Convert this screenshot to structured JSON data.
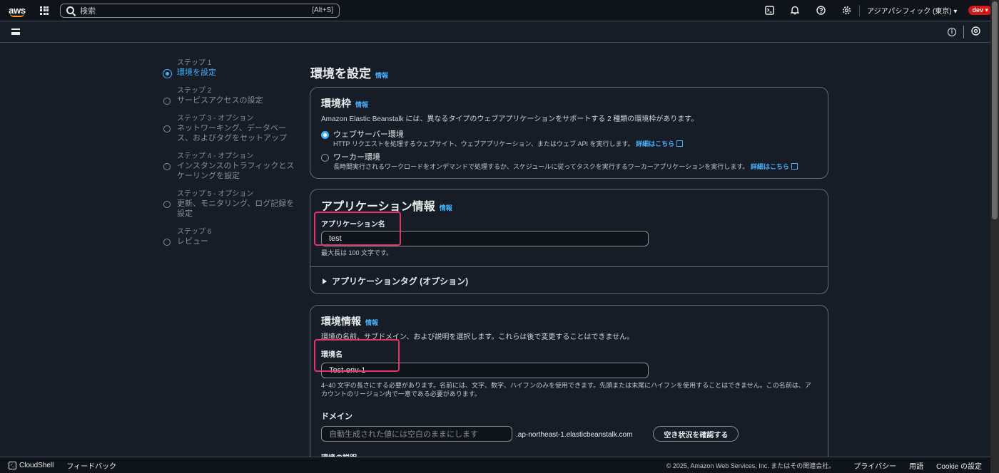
{
  "topnav": {
    "logo": "aws",
    "search_placeholder": "検索",
    "search_shortcut": "[Alt+S]",
    "icons": [
      "cloudshell-icon",
      "bell-icon",
      "help-icon",
      "gear-icon"
    ],
    "region": "アジアパシフィック (東京)",
    "account": "dev"
  },
  "steps": [
    {
      "num": "ステップ 1",
      "title": "環境を設定",
      "active": true
    },
    {
      "num": "ステップ 2",
      "title": "サービスアクセスの設定",
      "active": false
    },
    {
      "num": "ステップ 3 - オプション",
      "title": "ネットワーキング、データベース、およびタグをセットアップ",
      "active": false
    },
    {
      "num": "ステップ 4 - オプション",
      "title": "インスタンスのトラフィックとスケーリングを設定",
      "active": false
    },
    {
      "num": "ステップ 5 - オプション",
      "title": "更新、モニタリング、ログ記録を設定",
      "active": false
    },
    {
      "num": "ステップ 6",
      "title": "レビュー",
      "active": false
    }
  ],
  "page": {
    "title": "環境を設定",
    "info": "情報"
  },
  "env_tier": {
    "title": "環境枠",
    "info": "情報",
    "desc": "Amazon Elastic Beanstalk には、異なるタイプのウェブアプリケーションをサポートする 2 種類の環境枠があります。",
    "options": [
      {
        "label": "ウェブサーバー環境",
        "desc": "HTTP リクエストを処理するウェブサイト、ウェブアプリケーション、またはウェブ API を実行します。",
        "link": "詳細はこちら",
        "selected": true
      },
      {
        "label": "ワーカー環境",
        "desc": "長時間実行されるワークロードをオンデマンドで処理するか、スケジュールに従ってタスクを実行するワーカーアプリケーションを実行します。",
        "link": "詳細はこちら",
        "selected": false
      }
    ]
  },
  "app_info": {
    "title": "アプリケーション情報",
    "info": "情報",
    "name_label": "アプリケーション名",
    "name_value": "test",
    "name_hint": "最大長は 100 文字です。",
    "tags_label": "アプリケーションタグ (オプション)"
  },
  "env_info": {
    "title": "環境情報",
    "info": "情報",
    "desc": "環境の名前、サブドメイン、および説明を選択します。これらは後で変更することはできません。",
    "name_label": "環境名",
    "name_value": "Test-env-1",
    "name_hint": "4~40 文字の長さにする必要があります。名前には、文字、数字、ハイフンのみを使用できます。先頭または末尾にハイフンを使用することはできません。この名前は、アカウントのリージョン内で一意である必要があります。",
    "domain_label": "ドメイン",
    "domain_placeholder": "自動生成された値には空白のままにします",
    "domain_suffix": ".ap-northeast-1.elasticbeanstalk.com",
    "check_button": "空き状況を確認する",
    "desc_label": "環境の説明"
  },
  "footer": {
    "cloudshell": "CloudShell",
    "feedback": "フィードバック",
    "copyright": "© 2025, Amazon Web Services, Inc. またはその関連会社。",
    "privacy": "プライバシー",
    "terms": "用語",
    "cookie": "Cookie の設定"
  },
  "colors": {
    "accent": "#42b4ff",
    "highlight": "#e8336a",
    "account_badge": "#d91515"
  }
}
